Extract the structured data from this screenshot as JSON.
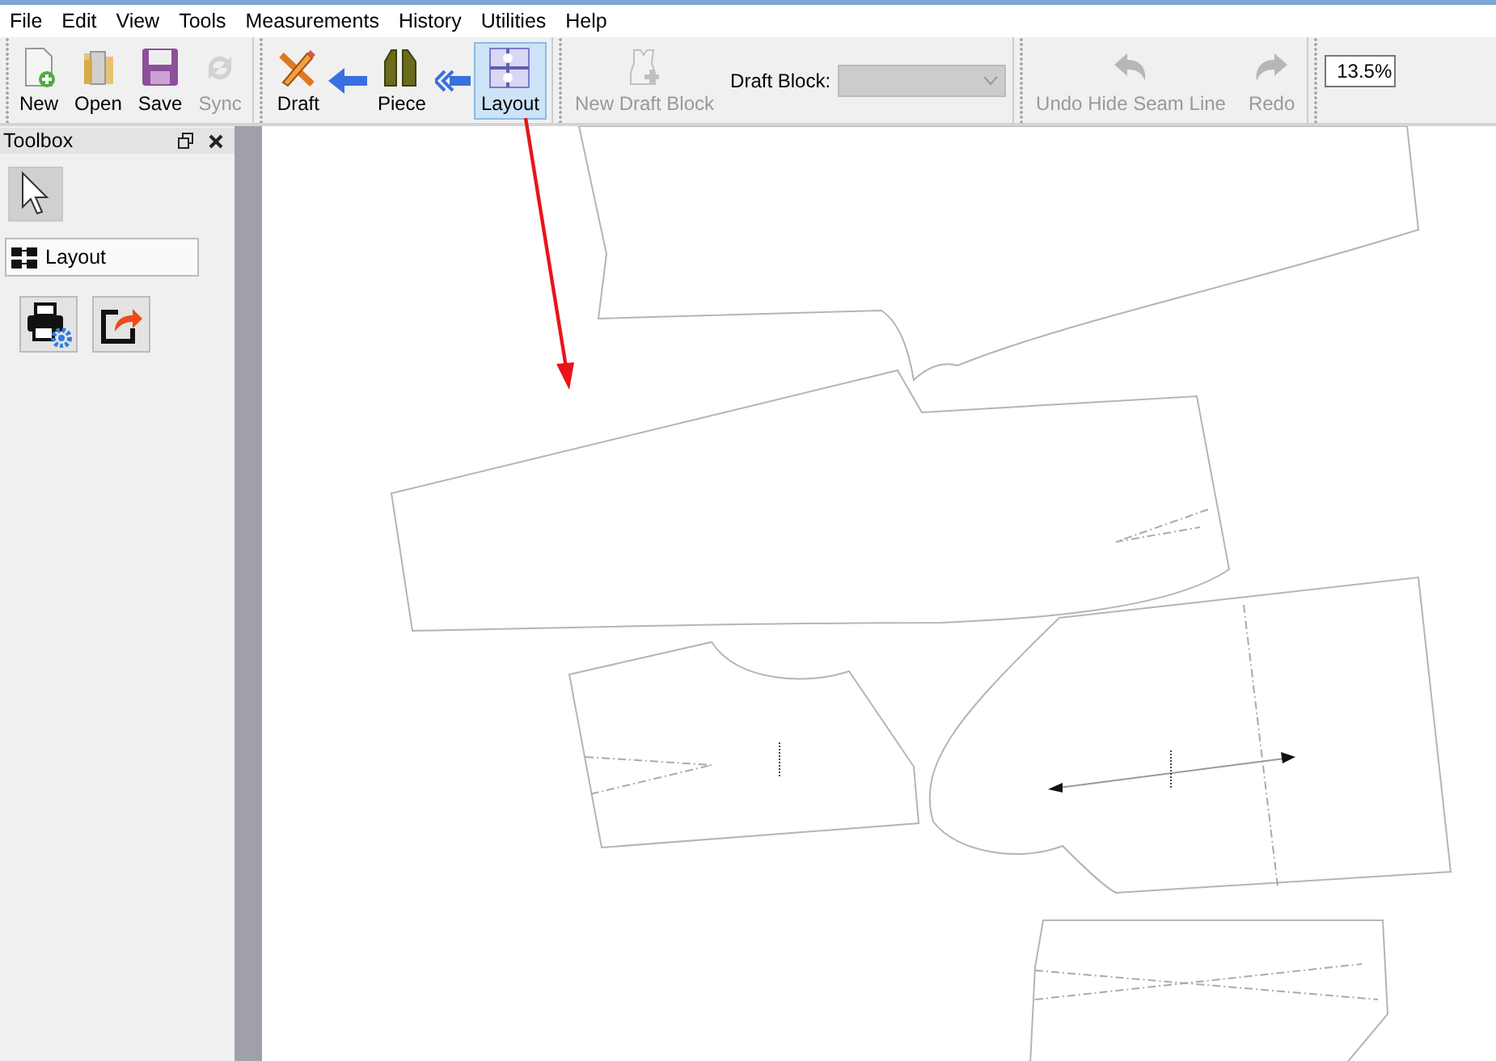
{
  "menu": [
    "File",
    "Edit",
    "View",
    "Tools",
    "Measurements",
    "History",
    "Utilities",
    "Help"
  ],
  "toolbar": {
    "file_buttons": [
      {
        "label": "New",
        "disabled": false
      },
      {
        "label": "Open",
        "disabled": false
      },
      {
        "label": "Save",
        "disabled": false
      },
      {
        "label": "Sync",
        "disabled": true
      }
    ],
    "mode_buttons": [
      {
        "label": "Draft",
        "selected": false
      },
      {
        "label": "Piece",
        "selected": false
      },
      {
        "label": "Layout",
        "selected": true
      }
    ],
    "draft": {
      "button": {
        "label": "New Draft Block",
        "disabled": true
      },
      "combo_label": "Draft Block:",
      "combo_disabled": true
    },
    "history_buttons": [
      {
        "label": "Undo Hide Seam Line",
        "disabled": true
      },
      {
        "label": "Redo",
        "disabled": true
      }
    ],
    "zoom": "13.5%"
  },
  "toolbox": {
    "title": "Toolbox",
    "pointer_selected": true,
    "section": "Layout"
  }
}
